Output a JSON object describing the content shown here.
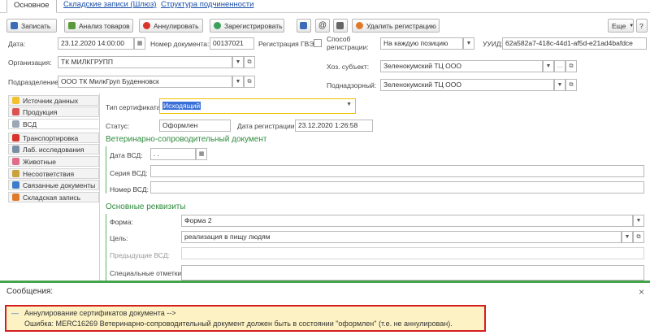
{
  "tabs": {
    "main": "Основное",
    "gateway": "Складские записи (Шлюз)",
    "subordination": "Структура подчиненности"
  },
  "toolbar": {
    "save": "Записать",
    "analyze": "Анализ товаров",
    "cancel": "Аннулировать",
    "register": "Зарегистрировать",
    "delete_reg": "Удалить регистрацию",
    "more": "Еще",
    "help": "?"
  },
  "header": {
    "date_label": "Дата:",
    "date_value": "23.12.2020 14:00:00",
    "docnum_label": "Номер документа:",
    "docnum_value": "00137021",
    "gvz_label": "Регистрация ГВЭ:",
    "method_label": "Способ регистрации:",
    "method_value": "На каждую позицию",
    "uuid_label": "УУИД:",
    "uuid_value": "62a582a7-418c-44d1-af5d-e21ad4bafdce",
    "org_label": "Организация:",
    "org_value": "ТК МИЛКГРУПП",
    "subject_label": "Хоз. субъект:",
    "subject_value": "Зеленокумский ТЦ ООО",
    "division_label": "Подразделение:",
    "division_value": "ООО ТК МилкГруп Буденновск",
    "supervised_label": "Поднадзорный:",
    "supervised_value": "Зеленокумский ТЦ ООО"
  },
  "nav": [
    "Источник данных",
    "Продукция",
    "ВСД",
    "Транспортировка",
    "Лаб. исследования",
    "Животные",
    "Несоответствия",
    "Связанные документы",
    "Складская запись"
  ],
  "nav_icon_colors": [
    "#f2c12e",
    "#d9534f",
    "#9aa7b5",
    "#d9342b",
    "#7a8fa6",
    "#e06b8a",
    "#c9a33a",
    "#3d7cc9",
    "#e07a2b"
  ],
  "vsd": {
    "cert_type_label": "Тип сертификата:",
    "cert_type_value": "Исходящий",
    "status_label": "Статус:",
    "status_value": "Оформлен",
    "regdate_label": "Дата регистрации:",
    "regdate_value": "23.12.2020  1:26:58",
    "section1": "Ветеринарно-сопроводительный документ",
    "vsd_date_label": "Дата ВСД:",
    "vsd_date_value": " .  .",
    "vsd_series_label": "Серия ВСД:",
    "vsd_number_label": "Номер ВСД:",
    "section2": "Основные реквизиты",
    "form_label": "Форма:",
    "form_value": "Форма 2",
    "purpose_label": "Цель:",
    "purpose_value": "реализация в пищу людям",
    "prev_vsd_label": "Предыдущие ВСД:",
    "special_label": "Специальные отметки:"
  },
  "messages": {
    "title": "Сообщения:",
    "close": "×",
    "line1": "Аннулирование сертификатов документа  -->",
    "line2": "Ошибка: MERC16269 Ветеринарно-сопроводительный документ должен быть в состоянии \"оформлен\" (т.е. не аннулирован)."
  }
}
